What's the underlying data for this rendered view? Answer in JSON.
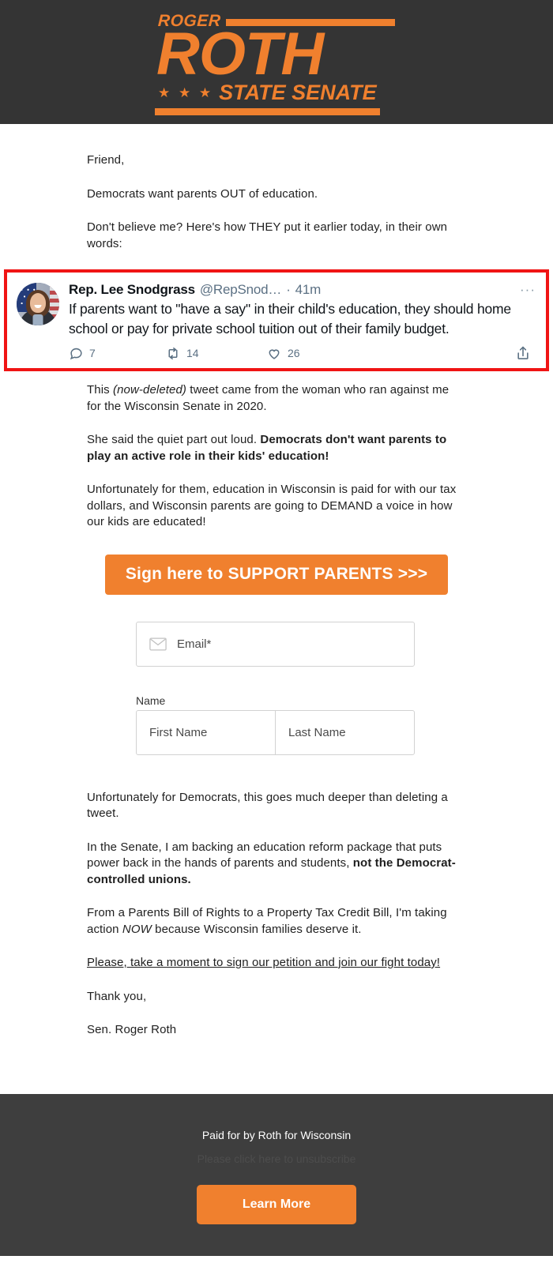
{
  "header": {
    "logo_line1": "ROGER",
    "logo_main": "ROTH",
    "logo_stars": "★ ★ ★",
    "logo_line3": "STATE SENATE",
    "brand_orange": "#F0802E",
    "brand_dark": "#343434"
  },
  "email_body": {
    "greeting": "Friend,",
    "para1": "Democrats want parents OUT of education.",
    "para2": "Don't believe me? Here's how THEY put it earlier today, in their own words:",
    "para3_pre": "This ",
    "para3_italic": "(now-deleted)",
    "para3_post": " tweet came from the woman who ran against me for the Wisconsin Senate in 2020.",
    "para4_pre": "She said the quiet part out loud. ",
    "para4_bold": "Democrats don't want parents to play an active role in their kids' education!",
    "para5": "Unfortunately for them, education in Wisconsin is paid for with our tax dollars, and Wisconsin parents are going to DEMAND a voice in how our kids are educated!",
    "para6": "Unfortunately for Democrats, this goes much deeper than deleting a tweet.",
    "para7_pre": "In the Senate, I am backing an education reform package that puts power back in the hands of parents and students, ",
    "para7_bold": "not the Democrat-controlled unions.",
    "para8_pre": "From a Parents Bill of Rights to a Property Tax Credit Bill, I'm taking action ",
    "para8_italic": "NOW",
    "para8_post": " because Wisconsin families deserve it.",
    "petition_link": "Please, take a moment to sign our petition and join our fight today!",
    "thanks": "Thank you,",
    "signature": "Sen. Roger Roth"
  },
  "tweet": {
    "display_name": "Rep. Lee Snodgrass",
    "handle": "@RepSnod…",
    "separator": "·",
    "timestamp": "41m",
    "more_menu": "···",
    "text": "If parents want to \"have a say\" in their child's education, they should home school or pay for private school tuition out of their family budget.",
    "replies": "7",
    "retweets": "14",
    "likes": "26",
    "highlight_border_color": "#F01414"
  },
  "cta": {
    "label": "Sign here to SUPPORT PARENTS  >>>"
  },
  "form": {
    "email_placeholder": "Email*",
    "name_label": "Name",
    "first_name_placeholder": "First Name",
    "last_name_placeholder": "Last Name"
  },
  "footer": {
    "paid_for": "Paid for by Roth for Wisconsin",
    "unsubscribe": "Please click here to unsubscribe",
    "learn_more": "Learn More"
  }
}
